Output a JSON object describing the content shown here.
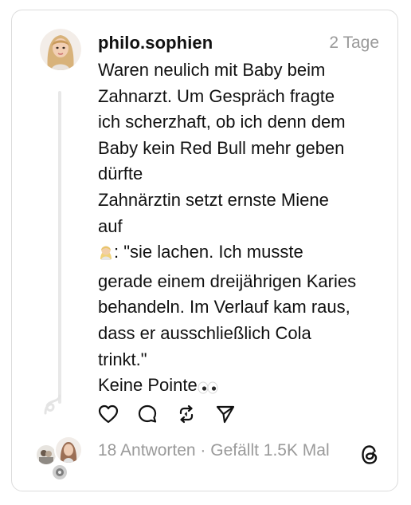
{
  "post": {
    "username": "philo.sophien",
    "time": "2 Tage",
    "lines": [
      "Waren neulich mit Baby beim",
      "Zahnarzt. Um Gespräch fragte",
      "ich scherzhaft, ob ich denn dem",
      "Baby kein Red Bull mehr geben",
      "dürfte",
      "Zahnärztin setzt ernste Miene",
      "auf"
    ],
    "quote_lines": [
      ": \"sie lachen. Ich musste",
      "gerade einem dreijährigen Karies",
      "behandeln. Im Verlauf kam raus,",
      "dass er ausschließlich Cola",
      "trinkt.\""
    ],
    "last_line": "Keine Pointe"
  },
  "footer": {
    "stats": "18 Antworten · Gefällt 1.5K Mal"
  },
  "icons": {
    "like": "heart-icon",
    "reply": "comment-icon",
    "repost": "repost-icon",
    "share": "send-icon",
    "brand": "threads-logo"
  },
  "colors": {
    "text": "#111111",
    "muted": "#9a9a9a",
    "border": "#dcdcdc",
    "thread_line": "#e8e8e8"
  }
}
